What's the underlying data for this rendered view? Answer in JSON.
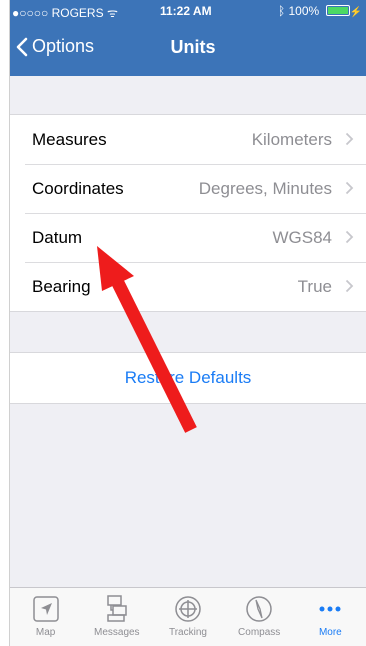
{
  "status": {
    "carrier": "●○○○○ ROGERS",
    "time": "11:22 AM",
    "battery": "100%",
    "battery_level": 1.0
  },
  "nav": {
    "back_label": "Options",
    "title": "Units"
  },
  "settings": [
    {
      "label": "Measures",
      "value": "Kilometers"
    },
    {
      "label": "Coordinates",
      "value": "Degrees, Minutes"
    },
    {
      "label": "Datum",
      "value": "WGS84"
    },
    {
      "label": "Bearing",
      "value": "True"
    }
  ],
  "restore_label": "Restore Defaults",
  "tabs": [
    {
      "label": "Map",
      "icon": "map-icon"
    },
    {
      "label": "Messages",
      "icon": "messages-icon"
    },
    {
      "label": "Tracking",
      "icon": "tracking-icon"
    },
    {
      "label": "Compass",
      "icon": "compass-icon"
    },
    {
      "label": "More",
      "icon": "more-icon",
      "active": true
    }
  ],
  "colors": {
    "nav_bar": "#3c74b8",
    "accent": "#1a7cf5",
    "annotation_arrow": "#ee1c1c"
  }
}
